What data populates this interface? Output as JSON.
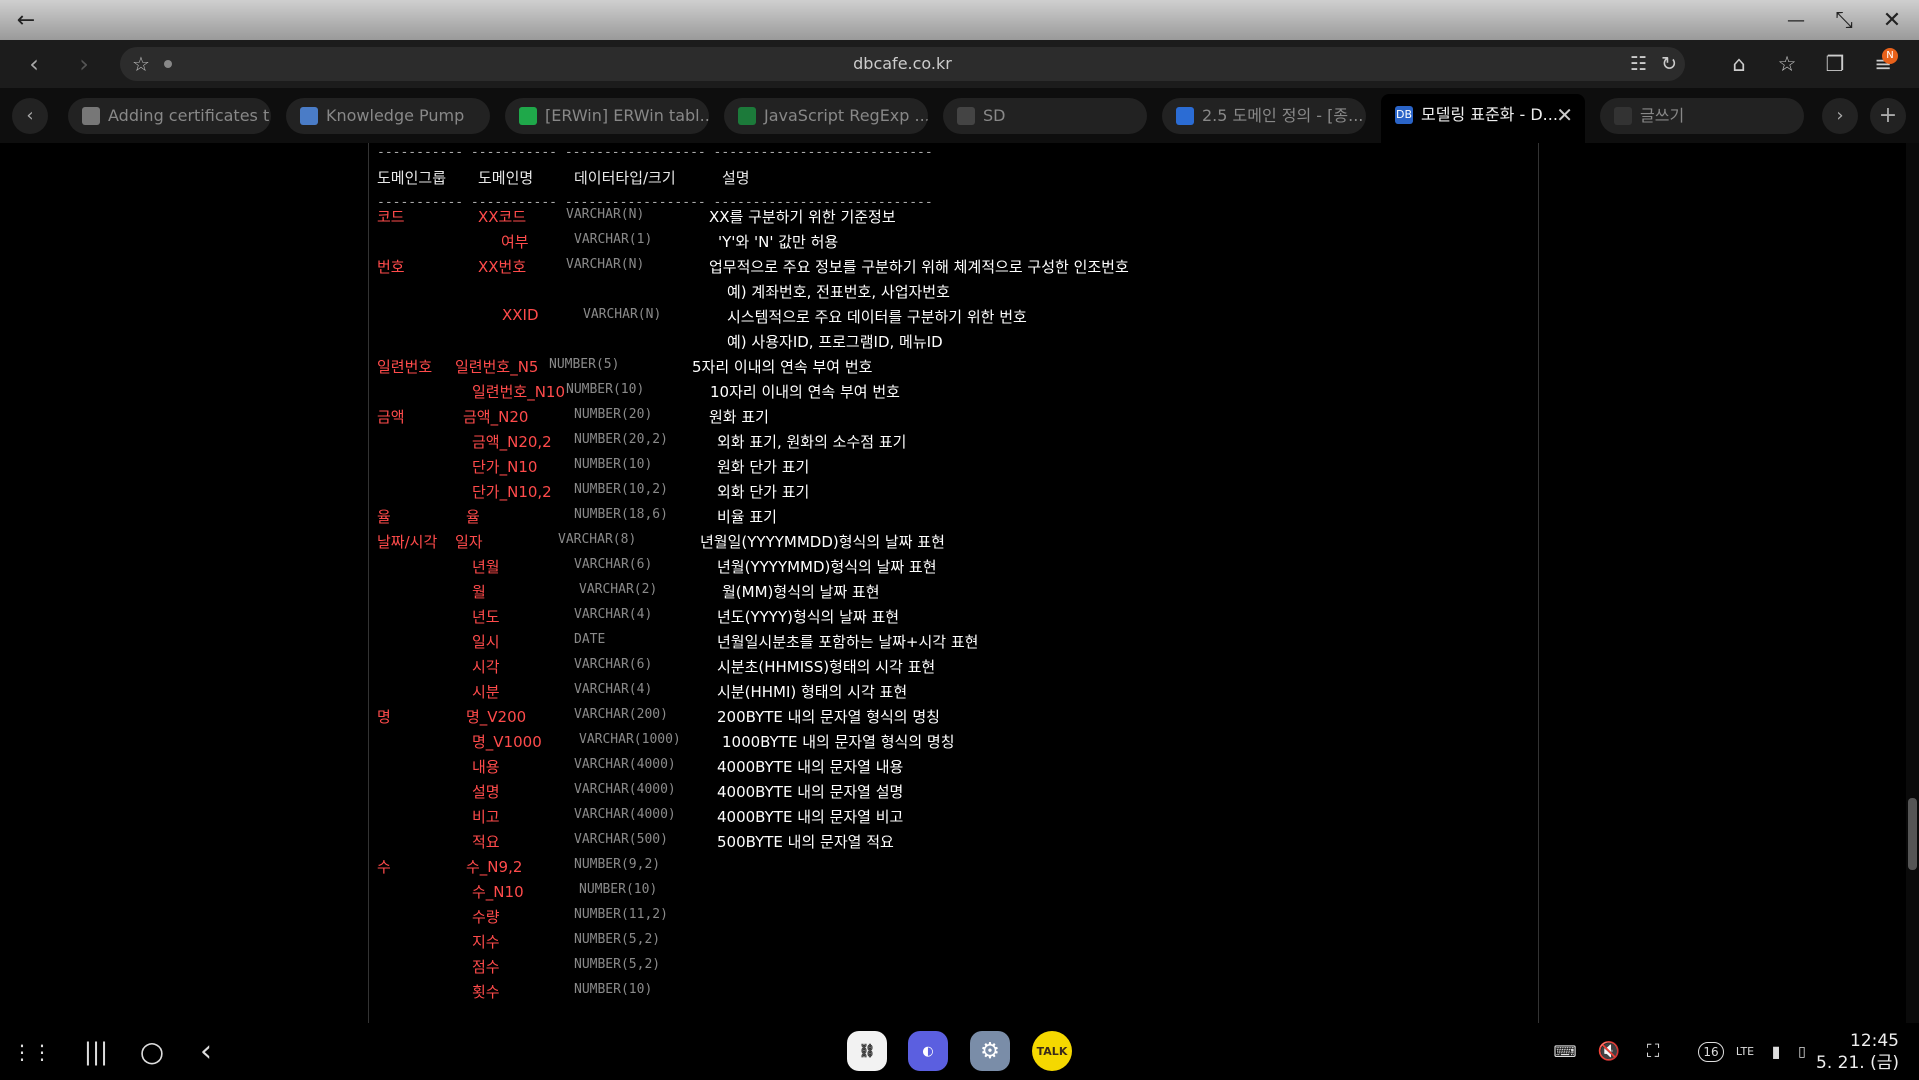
{
  "window": {
    "back": "←",
    "minimize": "—",
    "restore": "⤡",
    "close": "✕"
  },
  "browser": {
    "url": "dbcafe.co.kr",
    "badge": "N"
  },
  "tabs": [
    {
      "label": "Adding certificates t...",
      "color": "#777"
    },
    {
      "label": "Knowledge Pump",
      "color": "#4a7cc7"
    },
    {
      "label": "[ERWin] ERWin tabl...",
      "color": "#1fa84a"
    },
    {
      "label": "JavaScript RegExp ...",
      "color": "#1c7a3a"
    },
    {
      "label": "SD",
      "color": "#444"
    },
    {
      "label": "2.5 도메인 정의 - [종...",
      "color": "#2b6cd4"
    },
    {
      "label": "모델링 표준화 - D...",
      "color": "#2a64c8",
      "icon_text": "DB"
    },
    {
      "label": "글쓰기",
      "color": "#333"
    }
  ],
  "table": {
    "dash_line": "----------- ----------- ------------------ ----------------------------",
    "headers": [
      "도메인그룹",
      "도메인명",
      "데이터타입/크기",
      "설명"
    ],
    "rows": [
      {
        "group": "코드",
        "name": "XX코드",
        "type": "VARCHAR(N)",
        "desc": "XX를 구분하기 위한 기준정보"
      },
      {
        "group": "",
        "name": "여부",
        "type": "VARCHAR(1)",
        "desc": "'Y'와 'N' 값만 허용"
      },
      {
        "group": "번호",
        "name": "XX번호",
        "type": "VARCHAR(N)",
        "desc": "업무적으로 주요 정보를 구분하기 위해 체계적으로 구성한 인조번호"
      },
      {
        "group": "",
        "name": "",
        "type": "",
        "desc": "예) 계좌번호, 전표번호, 사업자번호"
      },
      {
        "group": "",
        "name": "XXID",
        "type": "VARCHAR(N)",
        "desc": "시스템적으로 주요 데이터를 구분하기 위한 번호"
      },
      {
        "group": "",
        "name": "",
        "type": "",
        "desc": "예) 사용자ID, 프로그램ID, 메뉴ID"
      },
      {
        "group": "일련번호",
        "name": "일련번호_N5",
        "type": "NUMBER(5)",
        "desc": "5자리 이내의 연속 부여 번호"
      },
      {
        "group": "",
        "name": "일련번호_N10",
        "type": "NUMBER(10)",
        "desc": "10자리 이내의 연속 부여 번호"
      },
      {
        "group": "금액",
        "name": "금액_N20",
        "type": "NUMBER(20)",
        "desc": "원화 표기"
      },
      {
        "group": "",
        "name": "금액_N20,2",
        "type": "NUMBER(20,2)",
        "desc": "외화 표기, 원화의 소수점 표기"
      },
      {
        "group": "",
        "name": "단가_N10",
        "type": "NUMBER(10)",
        "desc": "원화 단가 표기"
      },
      {
        "group": "",
        "name": "단가_N10,2",
        "type": "NUMBER(10,2)",
        "desc": "외화 단가 표기"
      },
      {
        "group": "율",
        "name": "율",
        "type": "NUMBER(18,6)",
        "desc": "비율 표기"
      },
      {
        "group": "날짜/시각",
        "name": "일자",
        "type": "VARCHAR(8)",
        "desc": "년월일(YYYYMMDD)형식의 날짜 표현"
      },
      {
        "group": "",
        "name": "년월",
        "type": "VARCHAR(6)",
        "desc": "년월(YYYYMMD)형식의 날짜 표현"
      },
      {
        "group": "",
        "name": "월",
        "type": "VARCHAR(2)",
        "desc": "월(MM)형식의 날짜 표현"
      },
      {
        "group": "",
        "name": "년도",
        "type": "VARCHAR(4)",
        "desc": "년도(YYYY)형식의 날짜 표현"
      },
      {
        "group": "",
        "name": "일시",
        "type": "DATE",
        "desc": "년월일시분초를 포함하는 날짜+시각 표현"
      },
      {
        "group": "",
        "name": "시각",
        "type": "VARCHAR(6)",
        "desc": "시분초(HHMISS)형태의 시각 표현"
      },
      {
        "group": "",
        "name": "시분",
        "type": "VARCHAR(4)",
        "desc": "시분(HHMI) 형태의 시각 표현"
      },
      {
        "group": "명",
        "name": "명_V200",
        "type": "VARCHAR(200)",
        "desc": "200BYTE 내의 문자열 형식의 명칭"
      },
      {
        "group": "",
        "name": "명_V1000",
        "type": "VARCHAR(1000)",
        "desc": "1000BYTE 내의 문자열 형식의 명칭"
      },
      {
        "group": "",
        "name": "내용",
        "type": "VARCHAR(4000)",
        "desc": "4000BYTE 내의 문자열 내용"
      },
      {
        "group": "",
        "name": "설명",
        "type": "VARCHAR(4000)",
        "desc": "4000BYTE 내의 문자열 설명"
      },
      {
        "group": "",
        "name": "비고",
        "type": "VARCHAR(4000)",
        "desc": "4000BYTE 내의 문자열 비고"
      },
      {
        "group": "",
        "name": "적요",
        "type": "VARCHAR(500)",
        "desc": "500BYTE 내의 문자열 적요"
      },
      {
        "group": "수",
        "name": "수_N9,2",
        "type": "NUMBER(9,2)",
        "desc": ""
      },
      {
        "group": "",
        "name": "수_N10",
        "type": "NUMBER(10)",
        "desc": ""
      },
      {
        "group": "",
        "name": "수량",
        "type": "NUMBER(11,2)",
        "desc": ""
      },
      {
        "group": "",
        "name": "지수",
        "type": "NUMBER(5,2)",
        "desc": ""
      },
      {
        "group": "",
        "name": "점수",
        "type": "NUMBER(5,2)",
        "desc": ""
      },
      {
        "group": "",
        "name": "횟수",
        "type": "NUMBER(10)",
        "desc": ""
      }
    ]
  },
  "taskbar": {
    "talk_label": "TALK",
    "time": "12:45",
    "date": "5. 21. (금)",
    "num_badge": "16",
    "lte": "LTE"
  }
}
